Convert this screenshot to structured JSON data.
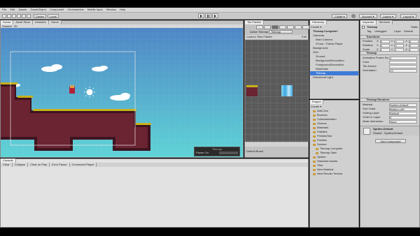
{
  "menu": [
    "File",
    "Edit",
    "Assets",
    "GameObject",
    "Component",
    "Cinemachine",
    "Mobile Input",
    "Window",
    "Help"
  ],
  "toolbar": {
    "pivot": "Center",
    "space": "Local",
    "collab": "Collab ▾",
    "account": "Account ▾",
    "layers": "Layers ▾",
    "layout": "Layout ▾"
  },
  "scene_tabs": [
    "Scene",
    "Asset Store",
    "Animator",
    "Game"
  ],
  "scene_toolbar": {
    "shading": "Shaded",
    "mode": "2D"
  },
  "palette": {
    "tab": "Tile Palette",
    "active_tilemap_label": "Active Tilemap",
    "active_tilemap_value": "Tilemap",
    "palette_name": "Custom Tiles Palette",
    "edit": "Edit",
    "default_brush": "Default Brush"
  },
  "hierarchy": {
    "tab": "Hierarchy",
    "create": "Create ▾",
    "scene": "Tilemap Complete*",
    "items": [
      {
        "label": "Cameras",
        "indent": 1
      },
      {
        "label": "Main Camera",
        "indent": 2
      },
      {
        "label": "VCam - Follow Player",
        "indent": 2
      },
      {
        "label": "Background",
        "indent": 1
      },
      {
        "label": "Grid",
        "indent": 1
      },
      {
        "label": "Ground",
        "indent": 2
      },
      {
        "label": "BackgroundDecoration",
        "indent": 2
      },
      {
        "label": "ForegroundDecoration",
        "indent": 2
      },
      {
        "label": "Waterfalls",
        "indent": 2
      },
      {
        "label": "Tilemap",
        "indent": 2,
        "selected": true
      },
      {
        "label": "Directional Light",
        "indent": 1
      }
    ]
  },
  "project": {
    "tab": "Project",
    "create": "Create ▾",
    "items": [
      {
        "label": "Add-Ons",
        "indent": 1
      },
      {
        "label": "Brushes",
        "indent": 1
      },
      {
        "label": "CollectableItem",
        "indent": 1
      },
      {
        "label": "Gizmos",
        "indent": 1
      },
      {
        "label": "Materials",
        "indent": 1
      },
      {
        "label": "Palettes",
        "indent": 1
      },
      {
        "label": "PrefabsTest",
        "indent": 1
      },
      {
        "label": "Prefabs",
        "indent": 1
      },
      {
        "label": "Scenes",
        "indent": 1
      },
      {
        "label": "Tilemap Complete",
        "indent": 2
      },
      {
        "label": "Tilemap Start",
        "indent": 2
      },
      {
        "label": "Sprites",
        "indent": 1
      },
      {
        "label": "Standard Assets",
        "indent": 1
      },
      {
        "label": "Tiles",
        "indent": 1
      },
      {
        "label": "New Material",
        "indent": 1
      },
      {
        "label": "New Render Texture",
        "indent": 1
      }
    ]
  },
  "console": {
    "tab": "Console",
    "buttons": [
      "Clear",
      "Collapse",
      "Clear on Play",
      "Error Pause",
      "Connected Player"
    ]
  },
  "game_overlay": {
    "title": "Tilemap",
    "label": "Pause On"
  },
  "inspector": {
    "tabs": [
      "Inspector",
      "Services"
    ],
    "object_name": "Tilemap",
    "static": "Static",
    "tag_label": "Tag",
    "tag_value": "Untagged",
    "layer_label": "Layer",
    "layer_value": "Default",
    "transform": {
      "title": "Transform",
      "rows": [
        {
          "label": "Position",
          "x": "0",
          "y": "0",
          "z": "0"
        },
        {
          "label": "Rotation",
          "x": "0",
          "y": "0",
          "z": "0"
        },
        {
          "label": "Scale",
          "x": "1",
          "y": "1",
          "z": "1"
        }
      ]
    },
    "tilemap": {
      "title": "Tilemap",
      "fields": [
        {
          "label": "Animation Frame Ra",
          "value": "1"
        },
        {
          "label": "Color",
          "value": ""
        },
        {
          "label": "Tile Anchor",
          "value": ""
        },
        {
          "label": "Orientation",
          "value": "XY"
        }
      ]
    },
    "renderer": {
      "title": "Tilemap Renderer",
      "fields": [
        {
          "label": "Material",
          "value": "Sprites-Default"
        },
        {
          "label": "Sort Order",
          "value": "Bottom Left"
        },
        {
          "label": "Sorting Layer",
          "value": "Default"
        },
        {
          "label": "Order in Layer",
          "value": "0"
        },
        {
          "label": "Mask Interaction",
          "value": "None"
        }
      ]
    },
    "material_preview": {
      "name": "Sprites-Default",
      "shader_label": "Shader",
      "shader": "Sprites/Default"
    },
    "add_component": "Add Component"
  },
  "colors": {
    "sky_top": "#4f86c6",
    "sky_bottom": "#5fd3d6",
    "dirt": "#6b2432",
    "dirt_dark": "#3e1420",
    "grass": "#c6b21d",
    "selection": "#3d7bd6"
  }
}
